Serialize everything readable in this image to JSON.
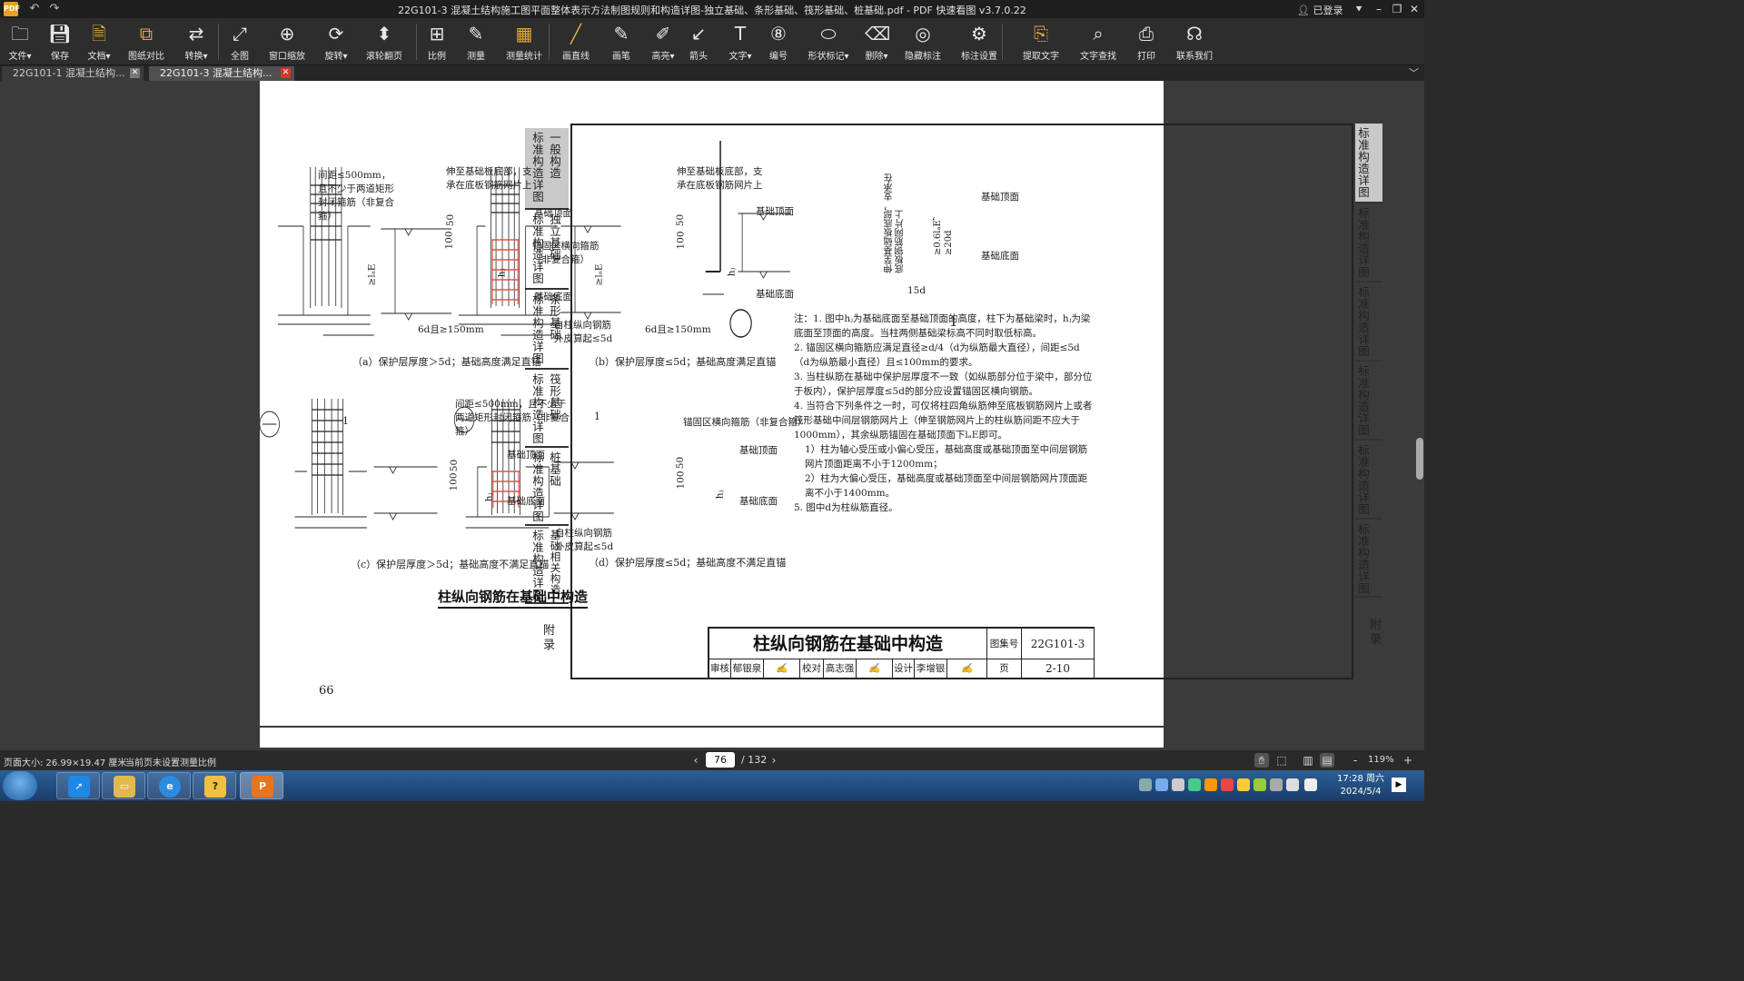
{
  "window": {
    "title": "22G101-3 混凝土结构施工图平面整体表示方法制图规则和构造详图-独立基础、条形基础、筏形基础、桩基础.pdf - PDF 快速看图 v3.7.0.22",
    "logo": "PDF",
    "login": "已登录"
  },
  "toolbar": [
    {
      "label": "文件▾",
      "icon": "folder-icon"
    },
    {
      "label": "保存",
      "icon": "save-icon"
    },
    {
      "label": "文档▾",
      "icon": "document-icon"
    },
    {
      "label": "图纸对比",
      "icon": "compare-icon"
    },
    {
      "label": "转换▾",
      "icon": "convert-icon"
    },
    {
      "label": "全图",
      "icon": "fit-all-icon"
    },
    {
      "label": "窗口缩放",
      "icon": "zoom-window-icon"
    },
    {
      "label": "旋转▾",
      "icon": "rotate-icon"
    },
    {
      "label": "滚轮翻页",
      "icon": "mouse-wheel-icon"
    },
    {
      "label": "比例",
      "icon": "scale-icon"
    },
    {
      "label": "测量",
      "icon": "measure-icon"
    },
    {
      "label": "测量统计",
      "icon": "measure-stats-icon"
    },
    {
      "label": "画直线",
      "icon": "line-icon"
    },
    {
      "label": "画笔",
      "icon": "pen-icon"
    },
    {
      "label": "高亮▾",
      "icon": "highlighter-icon"
    },
    {
      "label": "箭头",
      "icon": "arrow-icon"
    },
    {
      "label": "文字▾",
      "icon": "text-icon"
    },
    {
      "label": "编号",
      "icon": "number-icon"
    },
    {
      "label": "形状标记▾",
      "icon": "shape-mark-icon"
    },
    {
      "label": "删除▾",
      "icon": "eraser-icon"
    },
    {
      "label": "隐藏标注",
      "icon": "hide-annotation-icon"
    },
    {
      "label": "标注设置",
      "icon": "annotation-settings-icon"
    },
    {
      "label": "提取文字",
      "icon": "extract-text-icon"
    },
    {
      "label": "文字查找",
      "icon": "search-icon"
    },
    {
      "label": "打印",
      "icon": "print-icon"
    },
    {
      "label": "联系我们",
      "icon": "headset-icon"
    }
  ],
  "tabs": [
    {
      "label": "22G101-1 混凝土结构..."
    },
    {
      "label": "22G101-3 混凝土结构..."
    }
  ],
  "document": {
    "side_tabs_left": [
      {
        "a": "标准构造详图",
        "b": "一般构造"
      },
      {
        "a": "标准构造详图",
        "b": "独立基础"
      },
      {
        "a": "标准构造详图",
        "b": "条形基础"
      },
      {
        "a": "标准构造详图",
        "b": "筏形基础"
      },
      {
        "a": "标准构造详图",
        "b": "桩基础"
      },
      {
        "a": "标准构造详图",
        "b": "基础相关构造"
      }
    ],
    "appendix": "附录",
    "labels": {
      "spacing_a": "间距≤500mm，且不少于两道矩形封闭箍筋（非复合箍）",
      "extend_a": "伸至基础板底部，支承在底板钢筋网片上",
      "top": "基础顶面",
      "bottom": "基础底面",
      "anchor_hoop": "锚固区横向箍筋（非复合箍）",
      "from_outer": "自柱纵向钢筋外皮算起≤5d",
      "six_d": "6d且≥150mm",
      "spacing_c": "间距≤500mm，且不少于两道矩形封闭箍筋（非复合箍）",
      "anchor_hoop_d": "锚固区横向箍筋（非复合箍）",
      "extend_1": "伸至基础板底部，支承在底板钢筋网片上",
      "len_1": "≥0.6lₐE，≥20d",
      "fifteen_d": "15d",
      "circle_1": "1",
      "dim_50": "50",
      "dim_100": "100",
      "lae": "≥lₐE",
      "hj": "hⱼ"
    },
    "captions": {
      "a": "（a）保护层厚度＞5d；基础高度满足直锚",
      "b": "（b）保护层厚度≤5d；基础高度满足直锚",
      "c": "（c）保护层厚度＞5d；基础高度不满足直锚",
      "d": "（d）保护层厚度≤5d；基础高度不满足直锚",
      "main": "柱纵向钢筋在基础中构造"
    },
    "notes": [
      "注：1. 图中hⱼ为基础底面至基础顶面的高度，柱下为基础梁时，hⱼ为梁底面至顶面的高度。当柱两侧基础梁标高不同时取低标高。",
      "2. 锚固区横向箍筋应满足直径≥d/4（d为纵筋最大直径），间距≤5d（d为纵筋最小直径）且≤100mm的要求。",
      "3. 当柱纵筋在基础中保护层厚度不一致（如纵筋部分位于梁中，部分位于板内），保护层厚度≤5d的部分应设置锚固区横向钢筋。",
      "4. 当符合下列条件之一时，可仅将柱四角纵筋伸至底板钢筋网片上或者筏形基础中间层钢筋网片上（伸至钢筋网片上的柱纵筋间距不应大于1000mm），其余纵筋锚固在基础顶面下lₐE即可。",
      "1）柱为轴心受压或小偏心受压，基础高度或基础顶面至中间层钢筋网片顶面距离不小于1200mm；",
      "2）柱为大偏心受压，基础高度或基础顶面至中间层钢筋网片顶面距离不小于1400mm。",
      "5. 图中d为柱纵筋直径。"
    ],
    "titleblock": {
      "title": "柱纵向钢筋在基础中构造",
      "atlas_label": "图集号",
      "atlas_no": "22G101-3",
      "page_label": "页",
      "page_no": "2-10",
      "review": "审核",
      "reviewer": "郁银泉",
      "check": "校对",
      "checker": "高志强",
      "design": "设计",
      "designer": "李增银"
    },
    "page_number": "66"
  },
  "status": {
    "page_size": "页面大小: 26.99×19.47 厘米",
    "scale_note": "当前页未设置测量比例",
    "current_page": "76",
    "total_pages": "/ 132",
    "zoom": "119%",
    "zoom_minus": "-",
    "zoom_plus": "+"
  },
  "taskbar": {
    "time": "17:28 周六",
    "date": "2024/5/4"
  }
}
